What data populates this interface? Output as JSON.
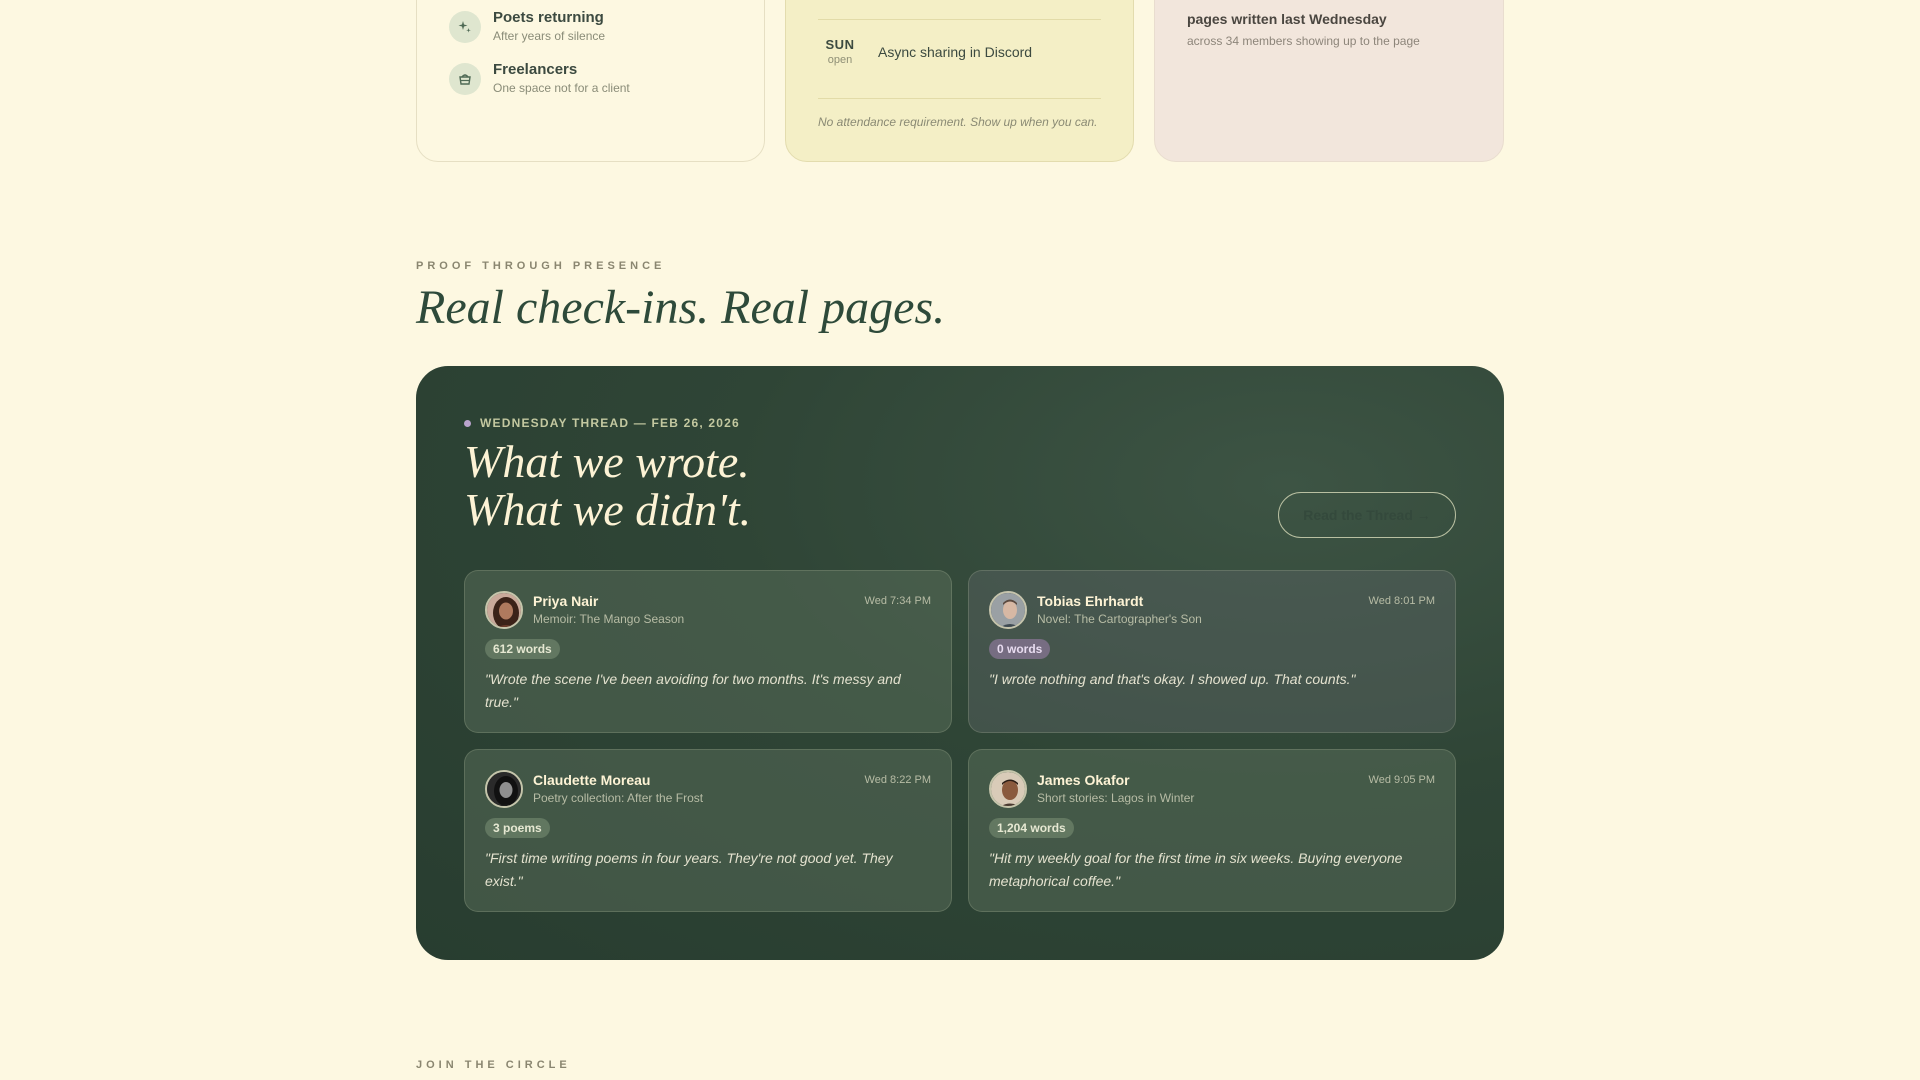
{
  "audience": {
    "items": [
      {
        "title": "Poets returning",
        "subtitle": "After years of silence",
        "icon": "sparkle-icon"
      },
      {
        "title": "Freelancers",
        "subtitle": "One space not for a client",
        "icon": "basket-icon"
      }
    ]
  },
  "schedule": {
    "rows": [
      {
        "day": "SUN",
        "status": "open",
        "event": "Async sharing in Discord"
      }
    ],
    "note": "No attendance requirement. Show up when you can."
  },
  "stats": {
    "title": "pages written last Wednesday",
    "subtitle": "across 34 members showing up to the page"
  },
  "proof": {
    "eyebrow": "PROOF THROUGH PRESENCE",
    "title": "Real check-ins. Real pages."
  },
  "thread": {
    "label": "WEDNESDAY THREAD — FEB 26, 2026",
    "title_line1": "What we wrote.",
    "title_line2": "What we didn't.",
    "read_button": "Read the Thread →",
    "checkins": [
      {
        "name": "Priya Nair",
        "project": "Memoir: The Mango Season",
        "time": "Wed 7:34 PM",
        "badge": "612 words",
        "quote": "\"Wrote the scene I've been avoiding for two months. It's messy and true.\""
      },
      {
        "name": "Tobias Ehrhardt",
        "project": "Novel: The Cartographer's Son",
        "time": "Wed 8:01 PM",
        "badge": "0 words",
        "quote": "\"I wrote nothing and that's okay. I showed up. That counts.\""
      },
      {
        "name": "Claudette Moreau",
        "project": "Poetry collection: After the Frost",
        "time": "Wed 8:22 PM",
        "badge": "3 poems",
        "quote": "\"First time writing poems in four years. They're not good yet. They exist.\""
      },
      {
        "name": "James Okafor",
        "project": "Short stories: Lagos in Winter",
        "time": "Wed 9:05 PM",
        "badge": "1,204 words",
        "quote": "\"Hit my weekly goal for the first time in six weeks. Buying everyone metaphorical coffee.\""
      }
    ]
  },
  "join": {
    "eyebrow": "JOIN THE CIRCLE"
  },
  "colors": {
    "background": "#fdf8e1",
    "panel": "#2f4536",
    "accent_cream": "#fdf3d5",
    "zero_badge": "#a082af"
  }
}
